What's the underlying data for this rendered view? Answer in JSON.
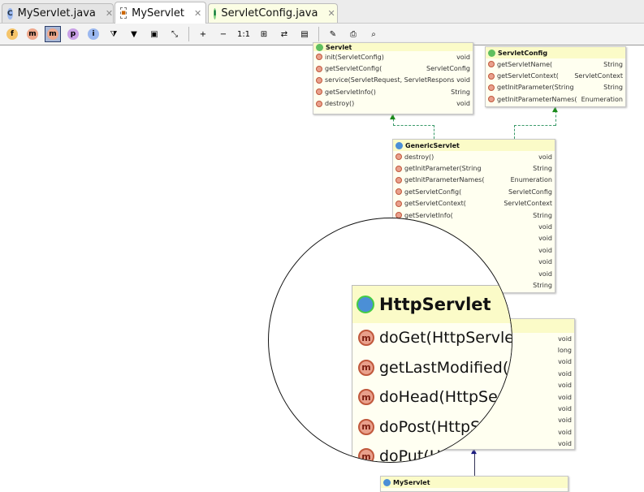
{
  "tabs": [
    {
      "label": "MyServlet.java",
      "icon": "class-icon",
      "active": false
    },
    {
      "label": "MyServlet",
      "icon": "diagram-icon",
      "active": true
    },
    {
      "label": "ServletConfig.java",
      "icon": "interface-icon",
      "active": false
    }
  ],
  "toolbar": [
    {
      "name": "fields-button",
      "glyph": "f"
    },
    {
      "name": "constructors-button",
      "glyph": "m"
    },
    {
      "name": "methods-button",
      "glyph": "m",
      "active": true
    },
    {
      "name": "properties-button",
      "glyph": "p"
    },
    {
      "name": "inner-classes-button",
      "glyph": "i"
    },
    {
      "name": "filter-dependencies-button",
      "glyph": "⧩"
    },
    {
      "name": "filter-button",
      "glyph": "▼"
    },
    {
      "name": "fit-content-button",
      "glyph": "▣"
    },
    {
      "name": "actual-size-button",
      "glyph": "⤡"
    },
    {
      "name": "zoom-in-button",
      "glyph": "+"
    },
    {
      "name": "zoom-out-button",
      "glyph": "−"
    },
    {
      "name": "zoom-reset-button",
      "glyph": "1:1"
    },
    {
      "name": "layout-button",
      "glyph": "⊞"
    },
    {
      "name": "apply-layout-button",
      "glyph": "⇄"
    },
    {
      "name": "save-button",
      "glyph": "▤"
    },
    {
      "name": "export-button",
      "glyph": "✎"
    },
    {
      "name": "print-button",
      "glyph": "⎙"
    },
    {
      "name": "print-preview-button",
      "glyph": "⌕"
    }
  ],
  "servlet": {
    "title": "Servlet",
    "rows": [
      [
        "init(ServletConfig)",
        "void"
      ],
      [
        "getServletConfig(",
        "ServletConfig"
      ],
      [
        "service(ServletRequest, ServletRespons",
        "void"
      ],
      [
        "getServletInfo()",
        "String"
      ],
      [
        "destroy()",
        "void"
      ]
    ]
  },
  "servlet_config": {
    "title": "ServletConfig",
    "rows": [
      [
        "getServletName(",
        "String"
      ],
      [
        "getServletContext(",
        "ServletContext"
      ],
      [
        "getInitParameter(String",
        "String"
      ],
      [
        "getInitParameterNames(",
        "Enumeration"
      ]
    ]
  },
  "generic_servlet": {
    "title": "GenericServlet",
    "rows": [
      [
        "destroy()",
        "void"
      ],
      [
        "getInitParameter(String",
        "String"
      ],
      [
        "getInitParameterNames(",
        "Enumeration"
      ],
      [
        "getServletConfig(",
        "ServletConfig"
      ],
      [
        "getServletContext(",
        "ServletContext"
      ],
      [
        "getServletInfo(",
        "String"
      ],
      [
        "tConfig)",
        "void"
      ],
      [
        "",
        "void"
      ],
      [
        "",
        "void"
      ],
      [
        "",
        "void"
      ],
      [
        "letRespons",
        "void"
      ],
      [
        "",
        "String"
      ]
    ]
  },
  "http_servlet_small": {
    "rows": [
      [
        "esponse",
        "void"
      ],
      [
        "",
        "long"
      ],
      [
        "tRespons",
        "void"
      ],
      [
        "tRespons",
        "void"
      ],
      [
        "tRespons",
        "void"
      ],
      [
        "ervletRespon",
        "void"
      ],
      [
        "ttpServletRespons",
        "void"
      ],
      [
        "ttpServletRespons",
        "void"
      ],
      [
        ", HttpServletRespons",
        "void"
      ],
      [
        ", ServletRespons",
        "void"
      ]
    ]
  },
  "magnifier": {
    "title": "HttpServlet",
    "rows": [
      "doGet(HttpServle",
      "getLastModified(",
      "doHead(HttpSer",
      "doPost(HttpS",
      "doPut(Htt"
    ]
  },
  "my_servlet": {
    "title": "MyServlet"
  }
}
